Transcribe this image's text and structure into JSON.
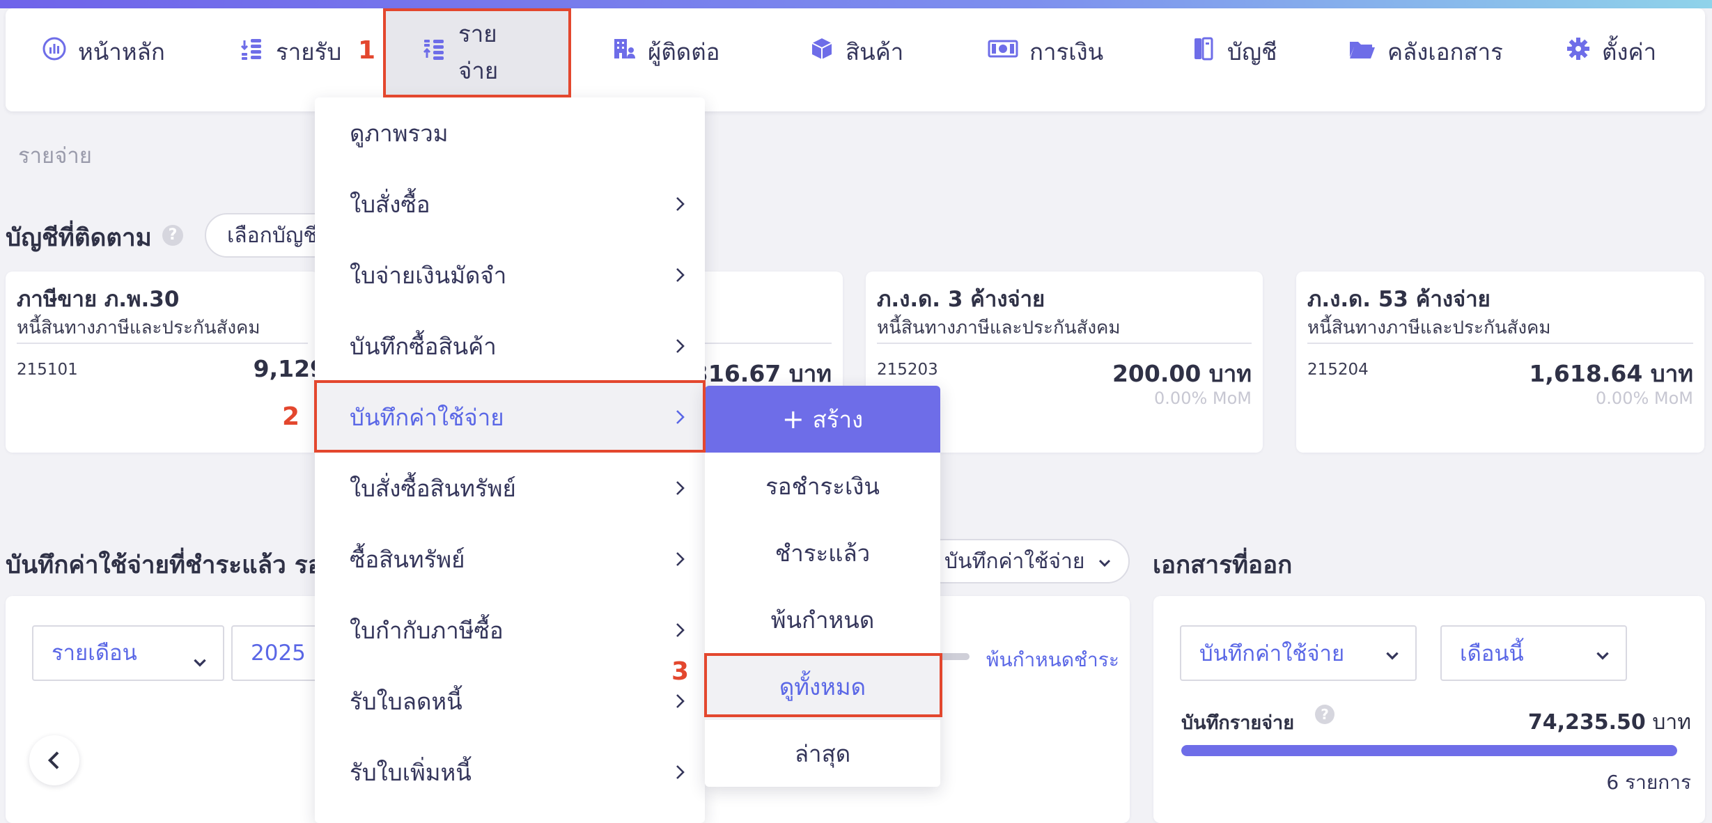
{
  "nav": [
    {
      "label": "หน้าหลัก",
      "icon": "chart-icon"
    },
    {
      "label": "รายรับ",
      "icon": "income-icon"
    },
    {
      "label": "รายจ่าย",
      "icon": "expense-icon"
    },
    {
      "label": "ผู้ติดต่อ",
      "icon": "building-icon"
    },
    {
      "label": "สินค้า",
      "icon": "box-icon"
    },
    {
      "label": "การเงิน",
      "icon": "money-icon"
    },
    {
      "label": "บัญชี",
      "icon": "ledger-icon"
    },
    {
      "label": "คลังเอกสาร",
      "icon": "folder-icon"
    },
    {
      "label": "ตั้งค่า",
      "icon": "gear-icon"
    }
  ],
  "annotations": {
    "step1": "1",
    "step2": "2",
    "step3": "3",
    "color": "#e3472e"
  },
  "breadcrumb": "รายจ่าย",
  "watched": {
    "title": "บัญชีที่ติดตาม",
    "help": "?",
    "select_label": "เลือกบัญชี",
    "cards": [
      {
        "title": "ภาษีขาย ภ.พ.30",
        "subtitle": "หนี้สินทางภาษีและประกันสังคม",
        "code": "215101",
        "amount": "9,129",
        "mom": ""
      },
      {
        "title": "",
        "subtitle": "",
        "code": "",
        "amount": ",316.67 บาท",
        "mom": ""
      },
      {
        "title": "ภ.ง.ด. 3 ค้างจ่าย",
        "subtitle": "หนี้สินทางภาษีและประกันสังคม",
        "code": "215203",
        "amount": "200.00 บาท",
        "mom": "0.00% MoM"
      },
      {
        "title": "ภ.ง.ด. 53 ค้างจ่าย",
        "subtitle": "หนี้สินทางภาษีและประกันสังคม",
        "code": "215204",
        "amount": "1,618.64 บาท",
        "mom": "0.00% MoM"
      }
    ]
  },
  "expenses_panel": {
    "title": "บันทึกค่าใช้จ่ายที่ชำระแล้ว รอชำ",
    "period_select": "รายเดือน",
    "year_select": "2025",
    "doc_type_select": "บันทึกค่าใช้จ่าย",
    "overdue_legend": "พ้นกำหนดชำระ"
  },
  "docs_panel": {
    "title": "เอกสารที่ออก",
    "type_select": "บันทึกค่าใช้จ่าย",
    "month_select": "เดือนนี้",
    "row_label": "บันทึกรายจ่าย",
    "help": "?",
    "amount": "74,235.50",
    "unit": "บาท",
    "progress": 1.0,
    "count": "6 รายการ"
  },
  "menu_expense": [
    {
      "label": "ดูภาพรวม",
      "sub": false
    },
    {
      "label": "ใบสั่งซื้อ",
      "sub": true
    },
    {
      "label": "ใบจ่ายเงินมัดจำ",
      "sub": true
    },
    {
      "label": "บันทึกซื้อสินค้า",
      "sub": true
    },
    {
      "label": "บันทึกค่าใช้จ่าย",
      "sub": true
    },
    {
      "label": "ใบสั่งซื้อสินทรัพย์",
      "sub": true
    },
    {
      "label": "ซื้อสินทรัพย์",
      "sub": true
    },
    {
      "label": "ใบกำกับภาษีซื้อ",
      "sub": true
    },
    {
      "label": "รับใบลดหนี้",
      "sub": true
    },
    {
      "label": "รับใบเพิ่มหนี้",
      "sub": true
    }
  ],
  "submenu": {
    "create": "สร้าง",
    "items": [
      "รอชำระเงิน",
      "ชำระแล้ว",
      "พ้นกำหนด",
      "ดูทั้งหมด",
      "ล่าสุด"
    ]
  },
  "colors": {
    "accent": "#6e6de8",
    "link": "#5a67e6",
    "annotation": "#e3472e",
    "text": "#34355a"
  }
}
